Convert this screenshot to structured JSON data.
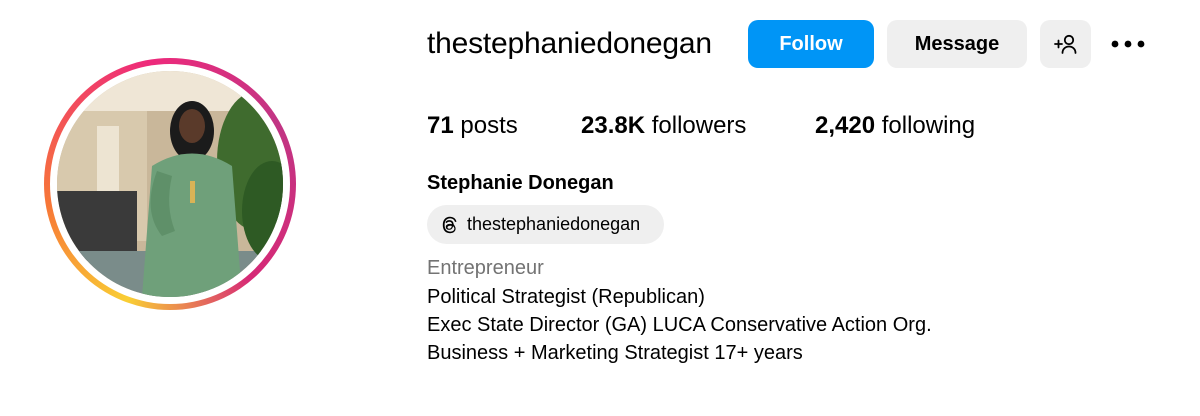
{
  "profile": {
    "username": "thestephaniedonegan",
    "full_name": "Stephanie Donegan",
    "avatar_icon": "profile-photo",
    "story_ring_colors": [
      "#f9ce34",
      "#ee2a7b",
      "#c13584"
    ]
  },
  "actions": {
    "follow_label": "Follow",
    "message_label": "Message",
    "suggest_icon": "add-person-icon",
    "more_icon": "more-options-icon",
    "follow_color": "#0095f6"
  },
  "stats": {
    "posts_count": "71",
    "posts_label": "posts",
    "followers_count": "23.8K",
    "followers_label": "followers",
    "following_count": "2,420",
    "following_label": "following"
  },
  "threads": {
    "icon": "threads-icon",
    "handle": "thestephaniedonegan"
  },
  "bio": {
    "category": "Entrepreneur",
    "lines": [
      "Political Strategist (Republican)",
      "Exec State Director (GA) LUCA Conservative Action Org.",
      "Business + Marketing Strategist 17+ years"
    ]
  }
}
